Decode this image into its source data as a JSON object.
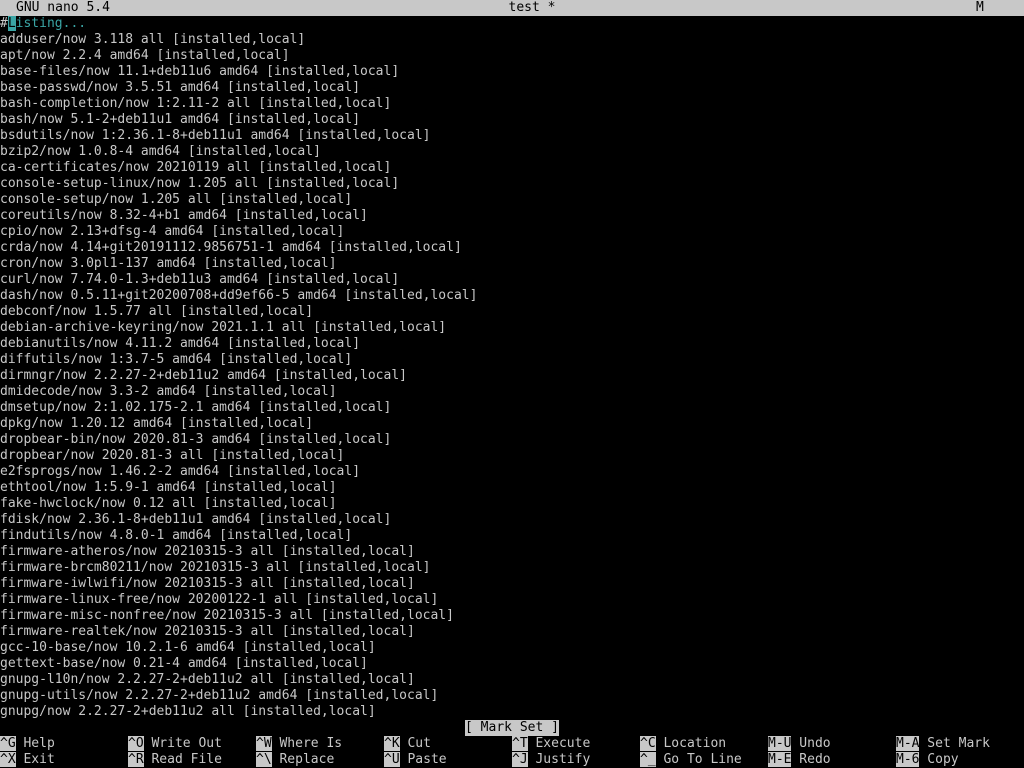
{
  "titlebar": {
    "app": "GNU nano 5.4",
    "filename": "test *",
    "modified": "M"
  },
  "editor": {
    "first_line": {
      "hash": "#",
      "cursor_char": "L",
      "rest": "isting..."
    },
    "lines": [
      "adduser/now 3.118 all [installed,local]",
      "apt/now 2.2.4 amd64 [installed,local]",
      "base-files/now 11.1+deb11u6 amd64 [installed,local]",
      "base-passwd/now 3.5.51 amd64 [installed,local]",
      "bash-completion/now 1:2.11-2 all [installed,local]",
      "bash/now 5.1-2+deb11u1 amd64 [installed,local]",
      "bsdutils/now 1:2.36.1-8+deb11u1 amd64 [installed,local]",
      "bzip2/now 1.0.8-4 amd64 [installed,local]",
      "ca-certificates/now 20210119 all [installed,local]",
      "console-setup-linux/now 1.205 all [installed,local]",
      "console-setup/now 1.205 all [installed,local]",
      "coreutils/now 8.32-4+b1 amd64 [installed,local]",
      "cpio/now 2.13+dfsg-4 amd64 [installed,local]",
      "crda/now 4.14+git20191112.9856751-1 amd64 [installed,local]",
      "cron/now 3.0pl1-137 amd64 [installed,local]",
      "curl/now 7.74.0-1.3+deb11u3 amd64 [installed,local]",
      "dash/now 0.5.11+git20200708+dd9ef66-5 amd64 [installed,local]",
      "debconf/now 1.5.77 all [installed,local]",
      "debian-archive-keyring/now 2021.1.1 all [installed,local]",
      "debianutils/now 4.11.2 amd64 [installed,local]",
      "diffutils/now 1:3.7-5 amd64 [installed,local]",
      "dirmngr/now 2.2.27-2+deb11u2 amd64 [installed,local]",
      "dmidecode/now 3.3-2 amd64 [installed,local]",
      "dmsetup/now 2:1.02.175-2.1 amd64 [installed,local]",
      "dpkg/now 1.20.12 amd64 [installed,local]",
      "dropbear-bin/now 2020.81-3 amd64 [installed,local]",
      "dropbear/now 2020.81-3 all [installed,local]",
      "e2fsprogs/now 1.46.2-2 amd64 [installed,local]",
      "ethtool/now 1:5.9-1 amd64 [installed,local]",
      "fake-hwclock/now 0.12 all [installed,local]",
      "fdisk/now 2.36.1-8+deb11u1 amd64 [installed,local]",
      "findutils/now 4.8.0-1 amd64 [installed,local]",
      "firmware-atheros/now 20210315-3 all [installed,local]",
      "firmware-brcm80211/now 20210315-3 all [installed,local]",
      "firmware-iwlwifi/now 20210315-3 all [installed,local]",
      "firmware-linux-free/now 20200122-1 all [installed,local]",
      "firmware-misc-nonfree/now 20210315-3 all [installed,local]",
      "firmware-realtek/now 20210315-3 all [installed,local]",
      "gcc-10-base/now 10.2.1-6 amd64 [installed,local]",
      "gettext-base/now 0.21-4 amd64 [installed,local]",
      "gnupg-l10n/now 2.2.27-2+deb11u2 all [installed,local]",
      "gnupg-utils/now 2.2.27-2+deb11u2 amd64 [installed,local]",
      "gnupg/now 2.2.27-2+deb11u2 all [installed,local]"
    ]
  },
  "status_message": "[ Mark Set ]",
  "shortcuts": [
    {
      "key": "^G",
      "label": "Help"
    },
    {
      "key": "^X",
      "label": "Exit"
    },
    {
      "key": "^O",
      "label": "Write Out"
    },
    {
      "key": "^R",
      "label": "Read File"
    },
    {
      "key": "^W",
      "label": "Where Is"
    },
    {
      "key": "^\\",
      "label": "Replace"
    },
    {
      "key": "^K",
      "label": "Cut"
    },
    {
      "key": "^U",
      "label": "Paste"
    },
    {
      "key": "^T",
      "label": "Execute"
    },
    {
      "key": "^J",
      "label": "Justify"
    },
    {
      "key": "^C",
      "label": "Location"
    },
    {
      "key": "^_",
      "label": "Go To Line"
    },
    {
      "key": "M-U",
      "label": "Undo"
    },
    {
      "key": "M-E",
      "label": "Redo"
    },
    {
      "key": "M-A",
      "label": "Set Mark"
    },
    {
      "key": "M-6",
      "label": "Copy"
    }
  ],
  "colors": {
    "background": "#000000",
    "foreground": "#c8c8c8",
    "inverse_bg": "#c8c8c8",
    "cursor": "#3aa5a5"
  }
}
